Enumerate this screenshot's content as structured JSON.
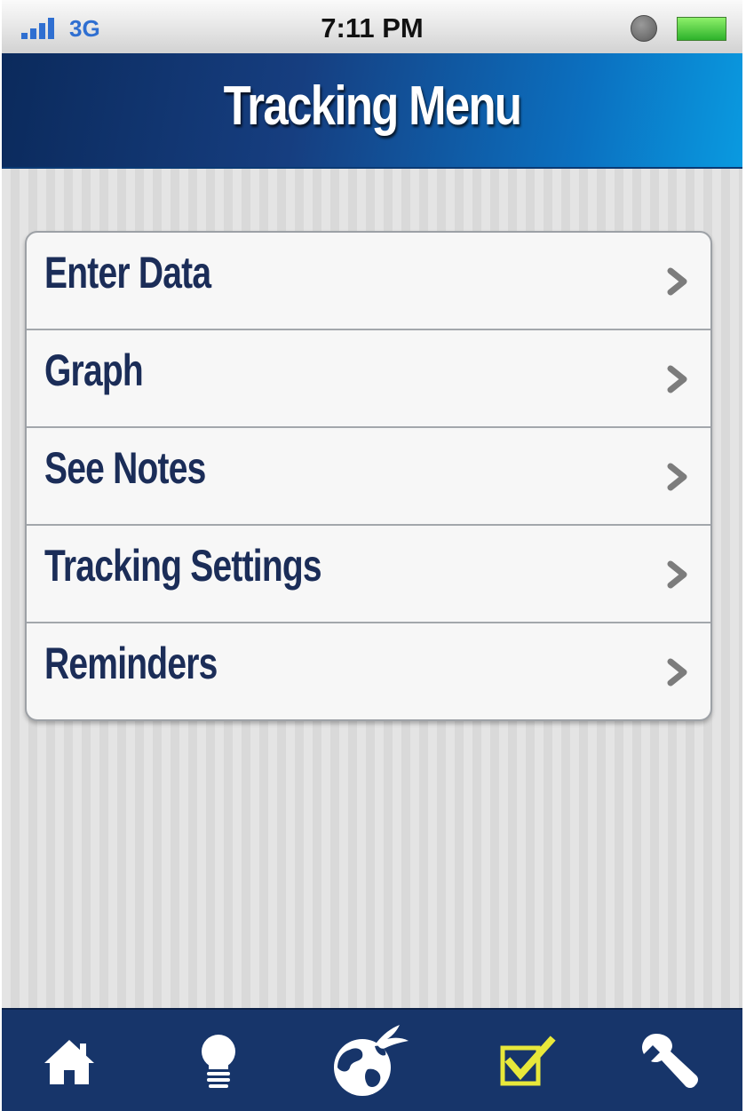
{
  "status_bar": {
    "network": "3G",
    "time": "7:11 PM"
  },
  "header": {
    "title": "Tracking Menu"
  },
  "menu": {
    "items": [
      {
        "label": "Enter Data",
        "icon": "chevron-right-icon"
      },
      {
        "label": "Graph",
        "icon": "chevron-right-icon"
      },
      {
        "label": "See Notes",
        "icon": "chevron-right-icon"
      },
      {
        "label": "Tracking Settings",
        "icon": "chevron-right-icon"
      },
      {
        "label": "Reminders",
        "icon": "chevron-right-icon"
      }
    ]
  },
  "tab_bar": {
    "tabs": [
      {
        "icon": "home-icon"
      },
      {
        "icon": "lightbulb-icon"
      },
      {
        "icon": "globe-eagle-icon"
      },
      {
        "icon": "checkbox-icon",
        "selected": true
      },
      {
        "icon": "wrench-icon"
      }
    ]
  },
  "colors": {
    "header_dark": "#0b2a5c",
    "header_light": "#0a9ae0",
    "menu_text": "#1b2d58",
    "tab_bar": "#17356a",
    "tab_selected": "#e8e83a",
    "signal": "#2f6fd1",
    "battery": "#2db22b"
  }
}
